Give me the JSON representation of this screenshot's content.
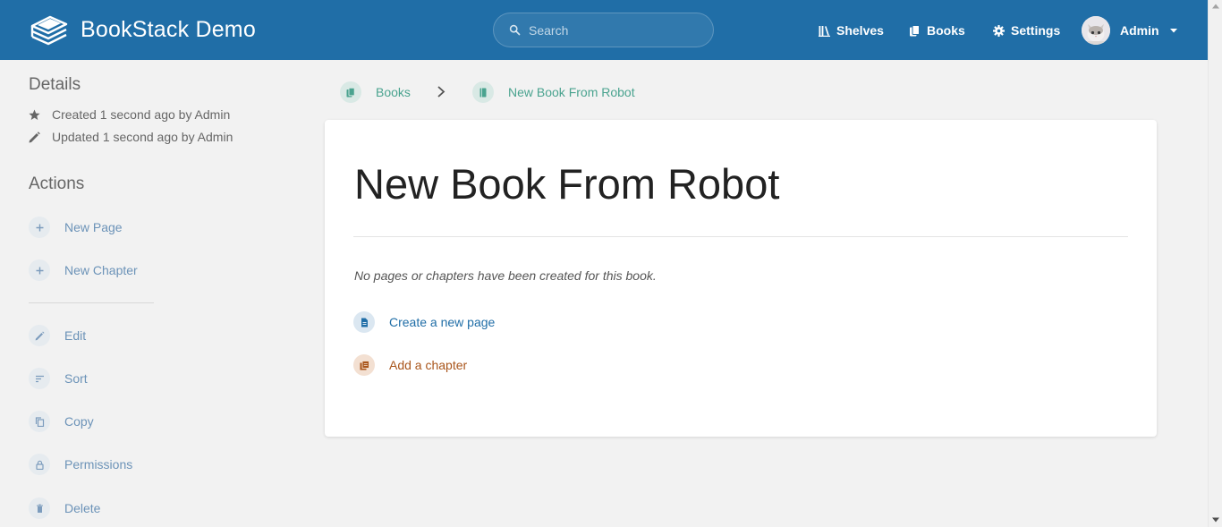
{
  "header": {
    "app_name": "BookStack Demo",
    "search_placeholder": "Search",
    "nav": [
      {
        "label": "Shelves",
        "icon": "shelves-icon"
      },
      {
        "label": "Books",
        "icon": "books-icon"
      },
      {
        "label": "Settings",
        "icon": "gear-icon"
      }
    ],
    "user_name": "Admin",
    "colors": {
      "header_bg": "#206ea7"
    }
  },
  "sidebar": {
    "details_heading": "Details",
    "created_text": "Created 1 second ago by Admin",
    "updated_text": "Updated 1 second ago by Admin",
    "actions_heading": "Actions",
    "actions": [
      {
        "label": "New Page",
        "icon": "plus-icon"
      },
      {
        "label": "New Chapter",
        "icon": "plus-icon"
      },
      {
        "label": "Edit",
        "icon": "pencil-icon"
      },
      {
        "label": "Sort",
        "icon": "sort-icon"
      },
      {
        "label": "Copy",
        "icon": "copy-icon"
      },
      {
        "label": "Permissions",
        "icon": "lock-icon"
      },
      {
        "label": "Delete",
        "icon": "trash-icon"
      }
    ]
  },
  "breadcrumb": {
    "items": [
      {
        "label": "Books",
        "icon": "books-icon"
      },
      {
        "label": "New Book From Robot",
        "icon": "book-icon"
      }
    ]
  },
  "main": {
    "title": "New Book From Robot",
    "empty_message": "No pages or chapters have been created for this book.",
    "create_page_label": "Create a new page",
    "add_chapter_label": "Add a chapter",
    "colors": {
      "page_link": "#206ea7",
      "chapter_link": "#a9551b",
      "book_accent": "#4aa38f"
    }
  }
}
